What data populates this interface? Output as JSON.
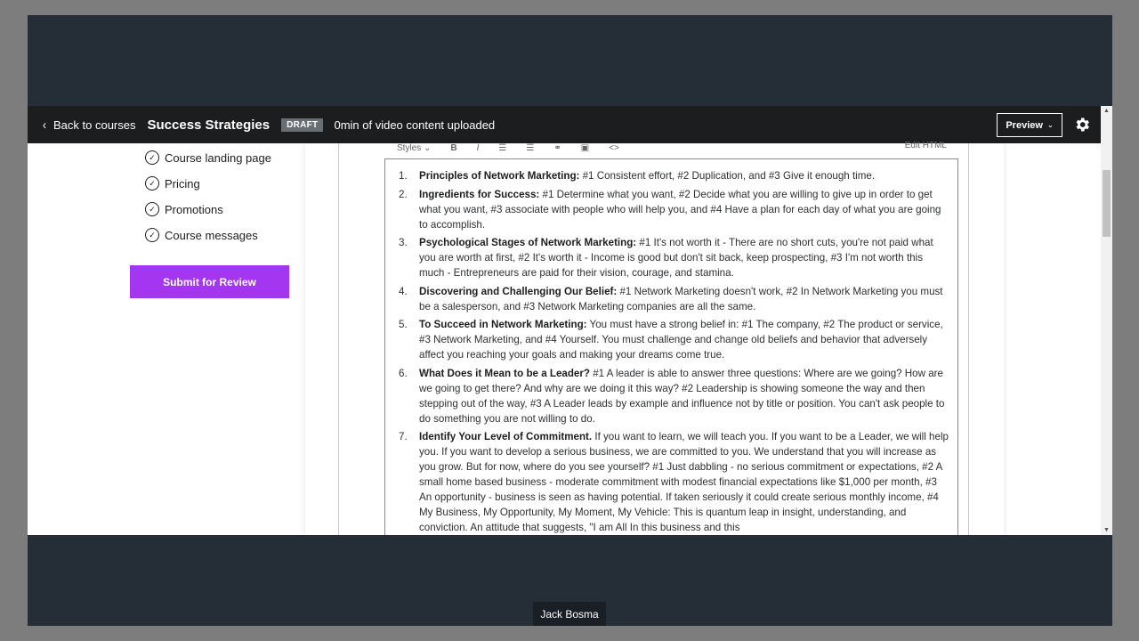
{
  "header": {
    "back_label": "Back to courses",
    "course_title": "Success Strategies",
    "status_badge": "DRAFT",
    "upload_status": "0min of video content uploaded",
    "preview_label": "Preview"
  },
  "sidebar": {
    "items": [
      {
        "label": "Course landing page"
      },
      {
        "label": "Pricing"
      },
      {
        "label": "Promotions"
      },
      {
        "label": "Course messages"
      }
    ],
    "submit_label": "Submit for Review"
  },
  "editor": {
    "toolbar": {
      "styles_label": "Styles",
      "edit_html_label": "Edit HTML"
    },
    "items": [
      {
        "num": "1.",
        "title": "Principles of Network Marketing:",
        "text": " #1 Consistent effort, #2 Duplication, and #3 Give it enough time."
      },
      {
        "num": "2.",
        "title": "Ingredients for Success:",
        "text": " #1 Determine what you want, #2 Decide what you are willing to give up in order to get what you want, #3 associate with people who will help you, and #4 Have a plan for each day of what you are going to accomplish."
      },
      {
        "num": "3.",
        "title": "Psychological Stages of Network Marketing:",
        "text": " #1 It's not worth it - There are no short cuts, you're not paid what you are worth at first, #2 It's worth it - Income is good but don't sit back, keep prospecting, #3 I'm not worth this much - Entrepreneurs are paid for their vision, courage, and stamina."
      },
      {
        "num": "4.",
        "title": "Discovering and Challenging Our Belief:",
        "text": " #1 Network Marketing doesn't work, #2 In Network Marketing you must be a salesperson, and #3 Network Marketing companies are all the same."
      },
      {
        "num": "5.",
        "title": "To Succeed in Network Marketing:",
        "text": " You must have a strong belief in: #1 The company, #2 The product or service, #3 Network Marketing, and #4 Yourself. You must challenge and change old beliefs and behavior that adversely affect you reaching your goals and making your dreams come true."
      },
      {
        "num": "6.",
        "title": "What Does it Mean to be a Leader?",
        "text": " #1 A leader is able to answer three questions: Where are we going? How are we going to get there? And why are we doing it this way? #2 Leadership is showing someone the way and then stepping out of the way, #3 A Leader leads by example and influence not by title or position. You can't ask people to do something you are not willing to do."
      },
      {
        "num": "7.",
        "title": "Identify Your Level of Commitment.",
        "text": " If you want to learn, we will teach you. If you want to be a Leader, we will help you. If you want to develop a serious business, we are committed to you. We understand that you will increase as you grow. But for now, where do you see yourself? #1 Just dabbling - no serious commitment or expectations, #2 A small home based business - moderate commitment with modest financial expectations like $1,000 per month, #3 An opportunity - business is seen as having potential. If taken seriously it could create serious monthly income, #4 My Business, My Opportunity, My Moment, My Vehicle: This is quantum leap in insight, understanding, and conviction. An attitude that suggests, \"I am All In this business and this"
      }
    ]
  },
  "participant": {
    "name": "Jack Bosma"
  }
}
